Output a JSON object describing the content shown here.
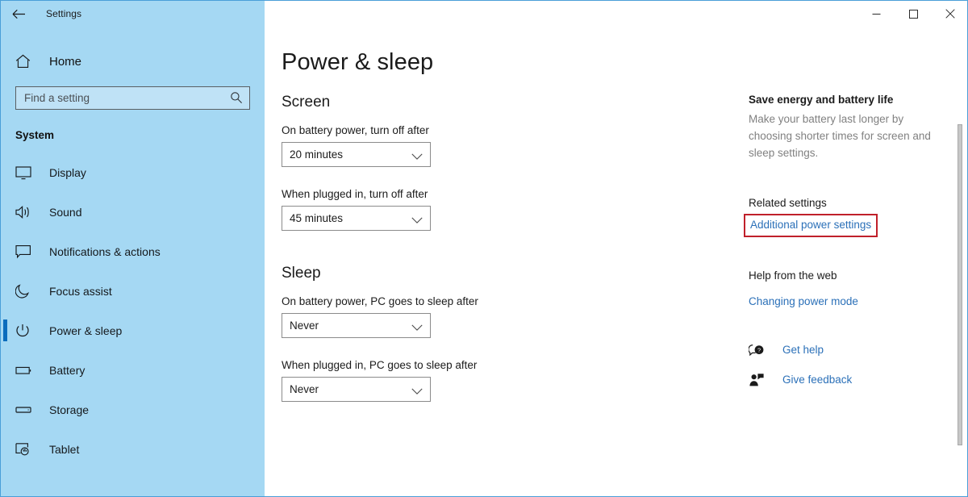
{
  "window": {
    "app_title": "Settings",
    "back_icon": "back-arrow-icon",
    "controls": {
      "minimize": "minimize-icon",
      "maximize": "maximize-icon",
      "close": "close-icon"
    }
  },
  "sidebar": {
    "home_label": "Home",
    "home_icon": "home-icon",
    "search": {
      "placeholder": "Find a setting",
      "value": "",
      "icon": "search-icon"
    },
    "category_label": "System",
    "items": [
      {
        "label": "Display",
        "icon": "monitor-icon",
        "selected": false
      },
      {
        "label": "Sound",
        "icon": "speaker-icon",
        "selected": false
      },
      {
        "label": "Notifications & actions",
        "icon": "notification-icon",
        "selected": false
      },
      {
        "label": "Focus assist",
        "icon": "moon-icon",
        "selected": false
      },
      {
        "label": "Power & sleep",
        "icon": "power-icon",
        "selected": true
      },
      {
        "label": "Battery",
        "icon": "battery-icon",
        "selected": false
      },
      {
        "label": "Storage",
        "icon": "storage-icon",
        "selected": false
      },
      {
        "label": "Tablet",
        "icon": "tablet-icon",
        "selected": false
      }
    ]
  },
  "main": {
    "page_title": "Power & sleep",
    "screen": {
      "heading": "Screen",
      "battery_label": "On battery power, turn off after",
      "battery_value": "20 minutes",
      "plugged_label": "When plugged in, turn off after",
      "plugged_value": "45 minutes"
    },
    "sleep": {
      "heading": "Sleep",
      "battery_label": "On battery power, PC goes to sleep after",
      "battery_value": "Never",
      "plugged_label": "When plugged in, PC goes to sleep after",
      "plugged_value": "Never"
    },
    "dropdown_icon": "chevron-down-icon"
  },
  "right_panel": {
    "save_energy_heading": "Save energy and battery life",
    "save_energy_body": "Make your battery last longer by choosing shorter times for screen and sleep settings.",
    "related_settings_heading": "Related settings",
    "additional_power_settings_link": "Additional power settings",
    "help_from_web_heading": "Help from the web",
    "changing_power_mode_link": "Changing power mode",
    "get_help_label": "Get help",
    "get_help_icon": "help-bubble-icon",
    "give_feedback_label": "Give feedback",
    "give_feedback_icon": "feedback-person-icon"
  },
  "colors": {
    "sidebar_bg": "#a5d8f3",
    "accent": "#0a6cbd",
    "link": "#2b70b8",
    "highlight_border": "#c0202a",
    "window_border": "#4a9fd8",
    "muted_text": "#818181"
  }
}
